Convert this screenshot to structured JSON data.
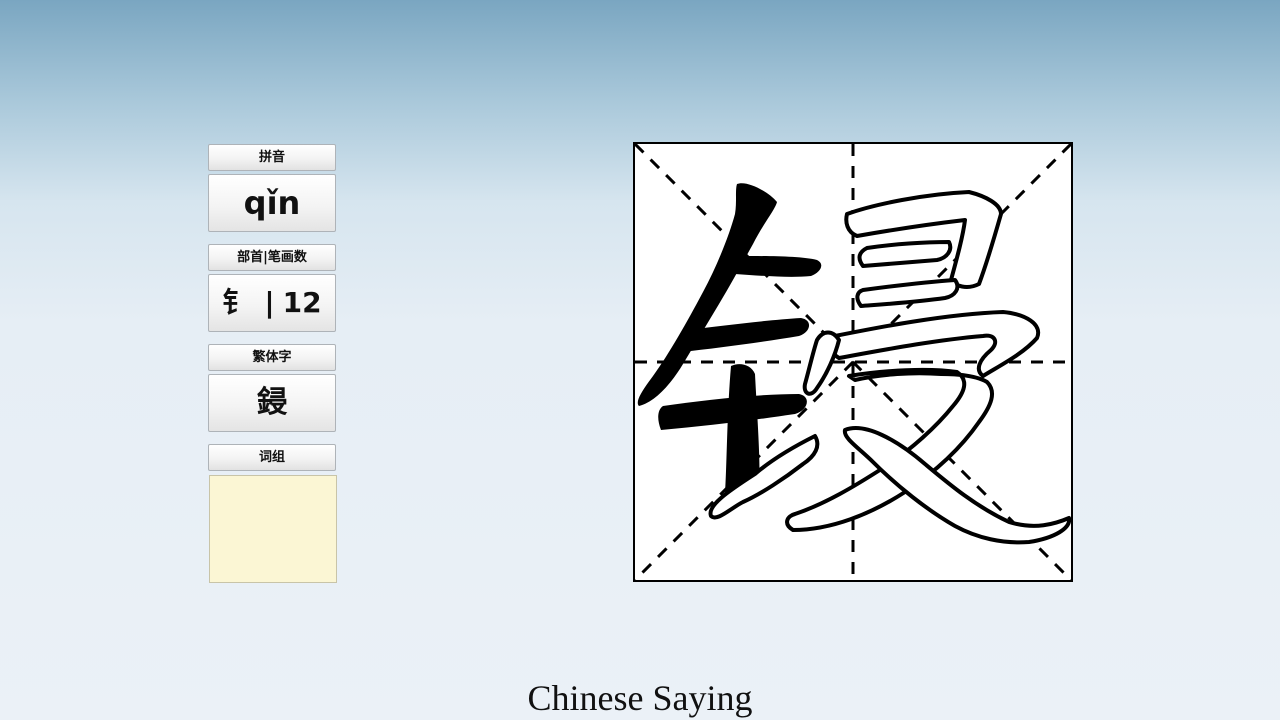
{
  "panel": {
    "pinyin_label": "拼音",
    "pinyin_value": "qǐn",
    "radical_strokes_label": "部首|笔画数",
    "radical": "钅",
    "separator": "|",
    "stroke_count": "12",
    "traditional_label": "繁体字",
    "traditional_value": "鋟",
    "words_label": "词组",
    "words_value": ""
  },
  "character_grid": {
    "character": "锓",
    "grid_style": "米字格 dashed guides",
    "highlighted_component": "钅",
    "outlined_component": "㝡"
  },
  "caption": "Chinese Saying"
}
